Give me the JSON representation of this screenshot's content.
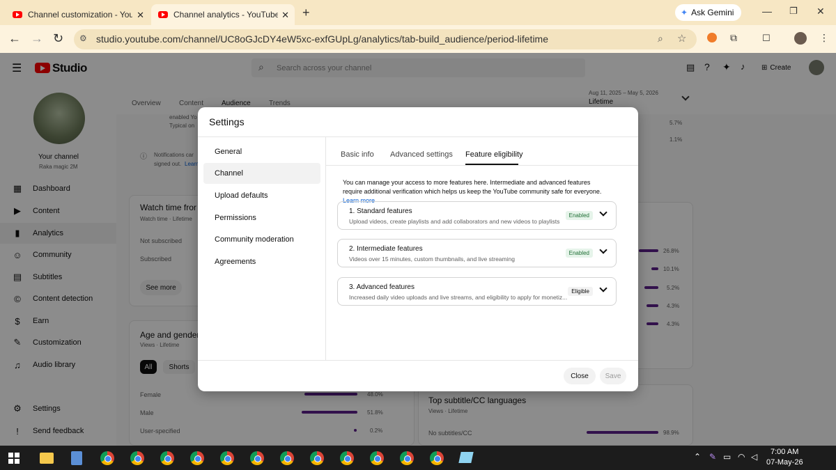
{
  "browser": {
    "tabs": [
      {
        "title": "Channel customization - YouTu"
      },
      {
        "title": "Channel analytics - YouTube St"
      }
    ],
    "new_tab": "+",
    "ask_gemini": "Ask Gemini",
    "url": "studio.youtube.com/channel/UC8oGJcDY4eW5xc-exfGUpLg/analytics/tab-build_audience/period-lifetime"
  },
  "studio": {
    "logo_text": "Studio",
    "search_placeholder": "Search across your channel",
    "create_label": "Create"
  },
  "sidebar": {
    "channel_label": "Your channel",
    "channel_name": "Raka magic 2M",
    "items": [
      {
        "label": "Dashboard",
        "icon": "dashboard-icon"
      },
      {
        "label": "Content",
        "icon": "content-icon"
      },
      {
        "label": "Analytics",
        "icon": "analytics-icon"
      },
      {
        "label": "Community",
        "icon": "community-icon"
      },
      {
        "label": "Subtitles",
        "icon": "subtitles-icon"
      },
      {
        "label": "Content detection",
        "icon": "copyright-icon"
      },
      {
        "label": "Earn",
        "icon": "dollar-icon"
      },
      {
        "label": "Customization",
        "icon": "wand-icon"
      },
      {
        "label": "Audio library",
        "icon": "audio-library-icon"
      }
    ],
    "settings": "Settings",
    "feedback": "Send feedback"
  },
  "analytics": {
    "tabs": [
      "Overview",
      "Content",
      "Audience",
      "Trends"
    ],
    "period_range": "Aug 11, 2025 – May 5, 2026",
    "period_label": "Lifetime",
    "bg_texts": {
      "enabled": "enabled Yo",
      "typical": "Typical on",
      "notifications": "Notifications car",
      "signed_out": "signed out.",
      "learn": "Learn",
      "watch_time_title": "Watch time fror",
      "watch_time_sub": "Watch time · Lifetime",
      "not_subscribed": "Not subscribed",
      "subscribed": "Subscribed",
      "see_more": "See more",
      "age_gender_title": "Age and gender",
      "age_gender_sub": "Views · Lifetime",
      "all": "All",
      "shorts": "Shorts",
      "female": "Female",
      "male": "Male",
      "user_specified": "User-specified",
      "female_pct": "48.0%",
      "male_pct": "51.8%",
      "user_pct": "0.2%",
      "top_subs_title": "Top subtitle/CC languages",
      "top_subs_sub": "Views · Lifetime",
      "no_subs": "No subtitles/CC",
      "no_subs_pct": "98.9%",
      "p1": "5.7%",
      "p2": "1.1%",
      "p3": "26.8%",
      "p4": "10.1%",
      "p5": "5.2%",
      "p6": "4.3%",
      "p7": "4.3%"
    }
  },
  "dialog": {
    "title": "Settings",
    "nav": [
      "General",
      "Channel",
      "Upload defaults",
      "Permissions",
      "Community moderation",
      "Agreements"
    ],
    "tabs": [
      "Basic info",
      "Advanced settings",
      "Feature eligibility"
    ],
    "description": "You can manage your access to more features here. Intermediate and advanced features require additional verification which helps us keep the YouTube community safe for everyone.",
    "learn_more": "Learn more",
    "features": [
      {
        "title": "1. Standard features",
        "subtitle": "Upload videos, create playlists and add collaborators and new videos to playlists",
        "status": "Enabled"
      },
      {
        "title": "2. Intermediate features",
        "subtitle": "Videos over 15 minutes, custom thumbnails, and live streaming",
        "status": "Enabled"
      },
      {
        "title": "3. Advanced features",
        "subtitle": "Increased daily video uploads and live streams, and eligibility to apply for monetiz...",
        "status": "Eligible"
      }
    ],
    "close": "Close",
    "save": "Save"
  },
  "taskbar": {
    "time": "7:00 AM",
    "date": "07-May-26"
  },
  "colors": {
    "tab_strip": "#f7e7c4",
    "toolbar": "#fdf3de",
    "accent_purple": "#5c1f8a",
    "link_blue": "#065fd4",
    "enabled_green": "#1e6e34"
  }
}
